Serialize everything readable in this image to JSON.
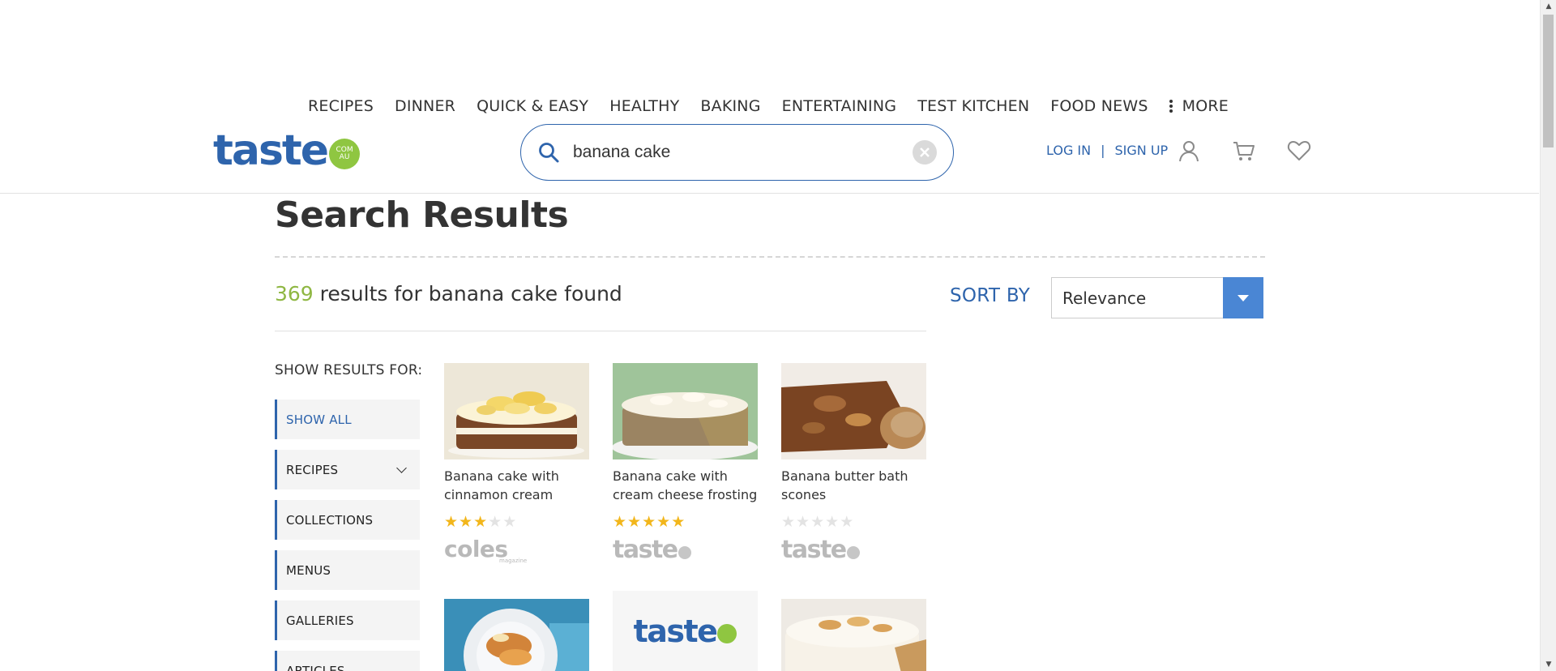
{
  "nav": {
    "items": [
      "RECIPES",
      "DINNER",
      "QUICK & EASY",
      "HEALTHY",
      "BAKING",
      "ENTERTAINING",
      "TEST KITCHEN",
      "FOOD NEWS"
    ],
    "more_label": "MORE"
  },
  "logo": {
    "word": "taste",
    "badge_top": "COM",
    "badge_bottom": "AU"
  },
  "search": {
    "value": "banana cake"
  },
  "auth": {
    "login": "LOG IN",
    "sep": "|",
    "signup": "SIGN UP"
  },
  "header_icons": [
    "user-icon",
    "cart-icon",
    "heart-icon"
  ],
  "page": {
    "title": "Search Results"
  },
  "results": {
    "count": "369",
    "text": "results for banana cake found"
  },
  "sort": {
    "label": "SORT BY",
    "value": "Relevance"
  },
  "filters": {
    "heading": "SHOW RESULTS FOR:",
    "items": [
      "SHOW ALL",
      "RECIPES",
      "COLLECTIONS",
      "MENUS",
      "GALLERIES",
      "ARTICLES"
    ]
  },
  "cards": [
    {
      "title": "Banana cake with cinnamon cream",
      "rating": 3,
      "source": "coles",
      "source_sub": "magazine"
    },
    {
      "title": "Banana cake with cream cheese frosting",
      "rating": 5,
      "source": "taste"
    },
    {
      "title": "Banana butter bath scones",
      "rating": 0,
      "source": "taste"
    },
    {
      "title": "",
      "rating": null,
      "source": ""
    },
    {
      "title": "",
      "rating": null,
      "source": "",
      "image_logo": "taste"
    },
    {
      "title": "",
      "rating": null,
      "source": ""
    }
  ],
  "colors": {
    "brand_blue": "#2e64ac",
    "accent_green": "#8fb743",
    "star": "#f2b61b"
  }
}
